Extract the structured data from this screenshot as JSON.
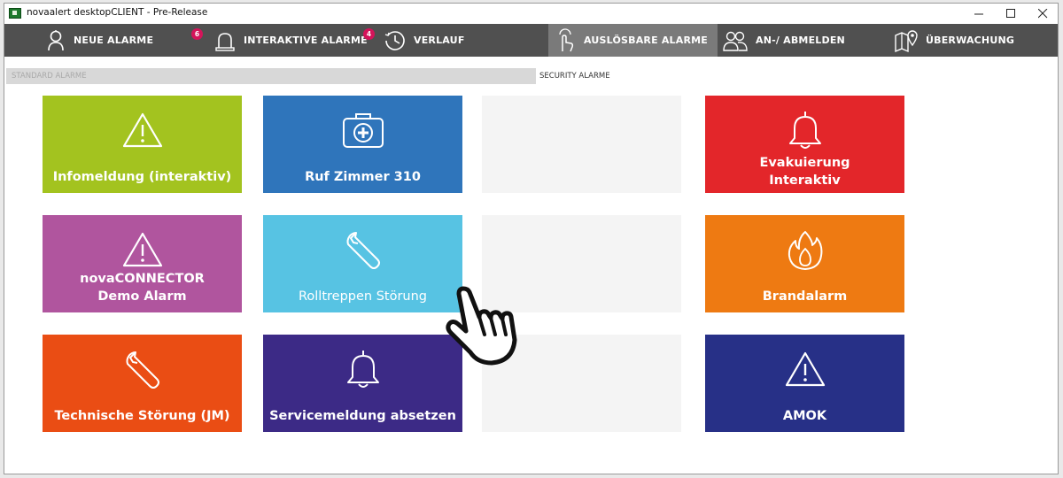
{
  "window": {
    "title": "novaalert desktopCLIENT - Pre-Release"
  },
  "nav": {
    "items": [
      {
        "label": "NEUE ALARME",
        "icon": "siren-person-icon",
        "badge": ""
      },
      {
        "label": "INTERAKTIVE ALARME",
        "icon": "siren-icon",
        "badge": "6"
      },
      {
        "label": "VERLAUF",
        "icon": "clock-icon",
        "badge": "4"
      },
      {
        "label": "AUSLÖSBARE ALARME",
        "icon": "touch-hand-icon",
        "badge": "",
        "active": true
      },
      {
        "label": "AN-/ ABMELDEN",
        "icon": "users-icon",
        "badge": ""
      },
      {
        "label": "ÜBERWACHUNG",
        "icon": "map-pin-icon",
        "badge": ""
      }
    ]
  },
  "tabs": {
    "standard": "STANDARD ALARME",
    "security": "SECURITY ALARME"
  },
  "tiles": [
    {
      "line1": "Infomeldung (interaktiv)",
      "line2": "",
      "icon": "warning-icon",
      "color": "#a3c31f"
    },
    {
      "line1": "Ruf Zimmer 310",
      "line2": "",
      "icon": "first-aid-kit-icon",
      "color": "#2f75bb"
    },
    {
      "line1": "Evakuierung",
      "line2": "Interaktiv",
      "icon": "bell-icon",
      "color": "#e3262a"
    },
    {
      "line1": "novaCONNECTOR",
      "line2": "Demo Alarm",
      "icon": "warning-icon",
      "color": "#b0559e"
    },
    {
      "line1": "Rolltreppen Störung",
      "line2": "",
      "icon": "wrench-icon",
      "color": "#57c3e3"
    },
    {
      "line1": "Brandalarm",
      "line2": "",
      "icon": "fire-icon",
      "color": "#ee7a12"
    },
    {
      "line1": "Technische Störung (JM)",
      "line2": "",
      "icon": "wrench-icon",
      "color": "#ea4d14"
    },
    {
      "line1": "Servicemeldung absetzen",
      "line2": "",
      "icon": "bell-icon",
      "color": "#3c2a86"
    },
    {
      "line1": "AMOK",
      "line2": "",
      "icon": "warning-icon",
      "color": "#273087"
    }
  ]
}
